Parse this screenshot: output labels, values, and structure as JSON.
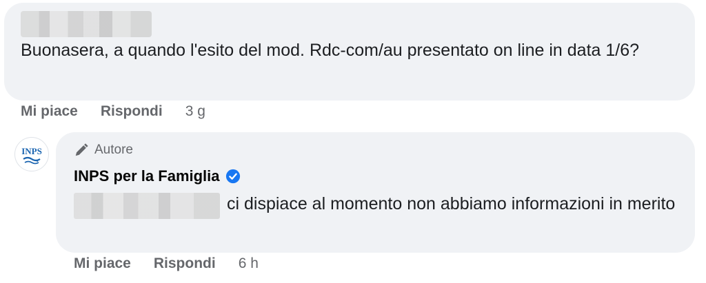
{
  "comment": {
    "text": "Buonasera, a quando l'esito del mod. Rdc-com/au presentato on line in data 1/6?",
    "actions": {
      "like": "Mi piace",
      "reply": "Rispondi",
      "time": "3 g"
    }
  },
  "reply": {
    "author_badge": "Autore",
    "page_name": "INPS per la Famiglia",
    "avatar_text": "INPS",
    "text": "ci dispiace al momento non abbiamo informazioni in merito",
    "actions": {
      "like": "Mi piace",
      "reply": "Rispondi",
      "time": "6 h"
    }
  },
  "colors": {
    "bubble": "#f0f2f5",
    "secondary_text": "#65676b",
    "verified": "#1877f2",
    "inps_blue": "#1a64b0"
  },
  "icons": {
    "author": "pen-icon",
    "verified": "verified-badge-icon"
  }
}
